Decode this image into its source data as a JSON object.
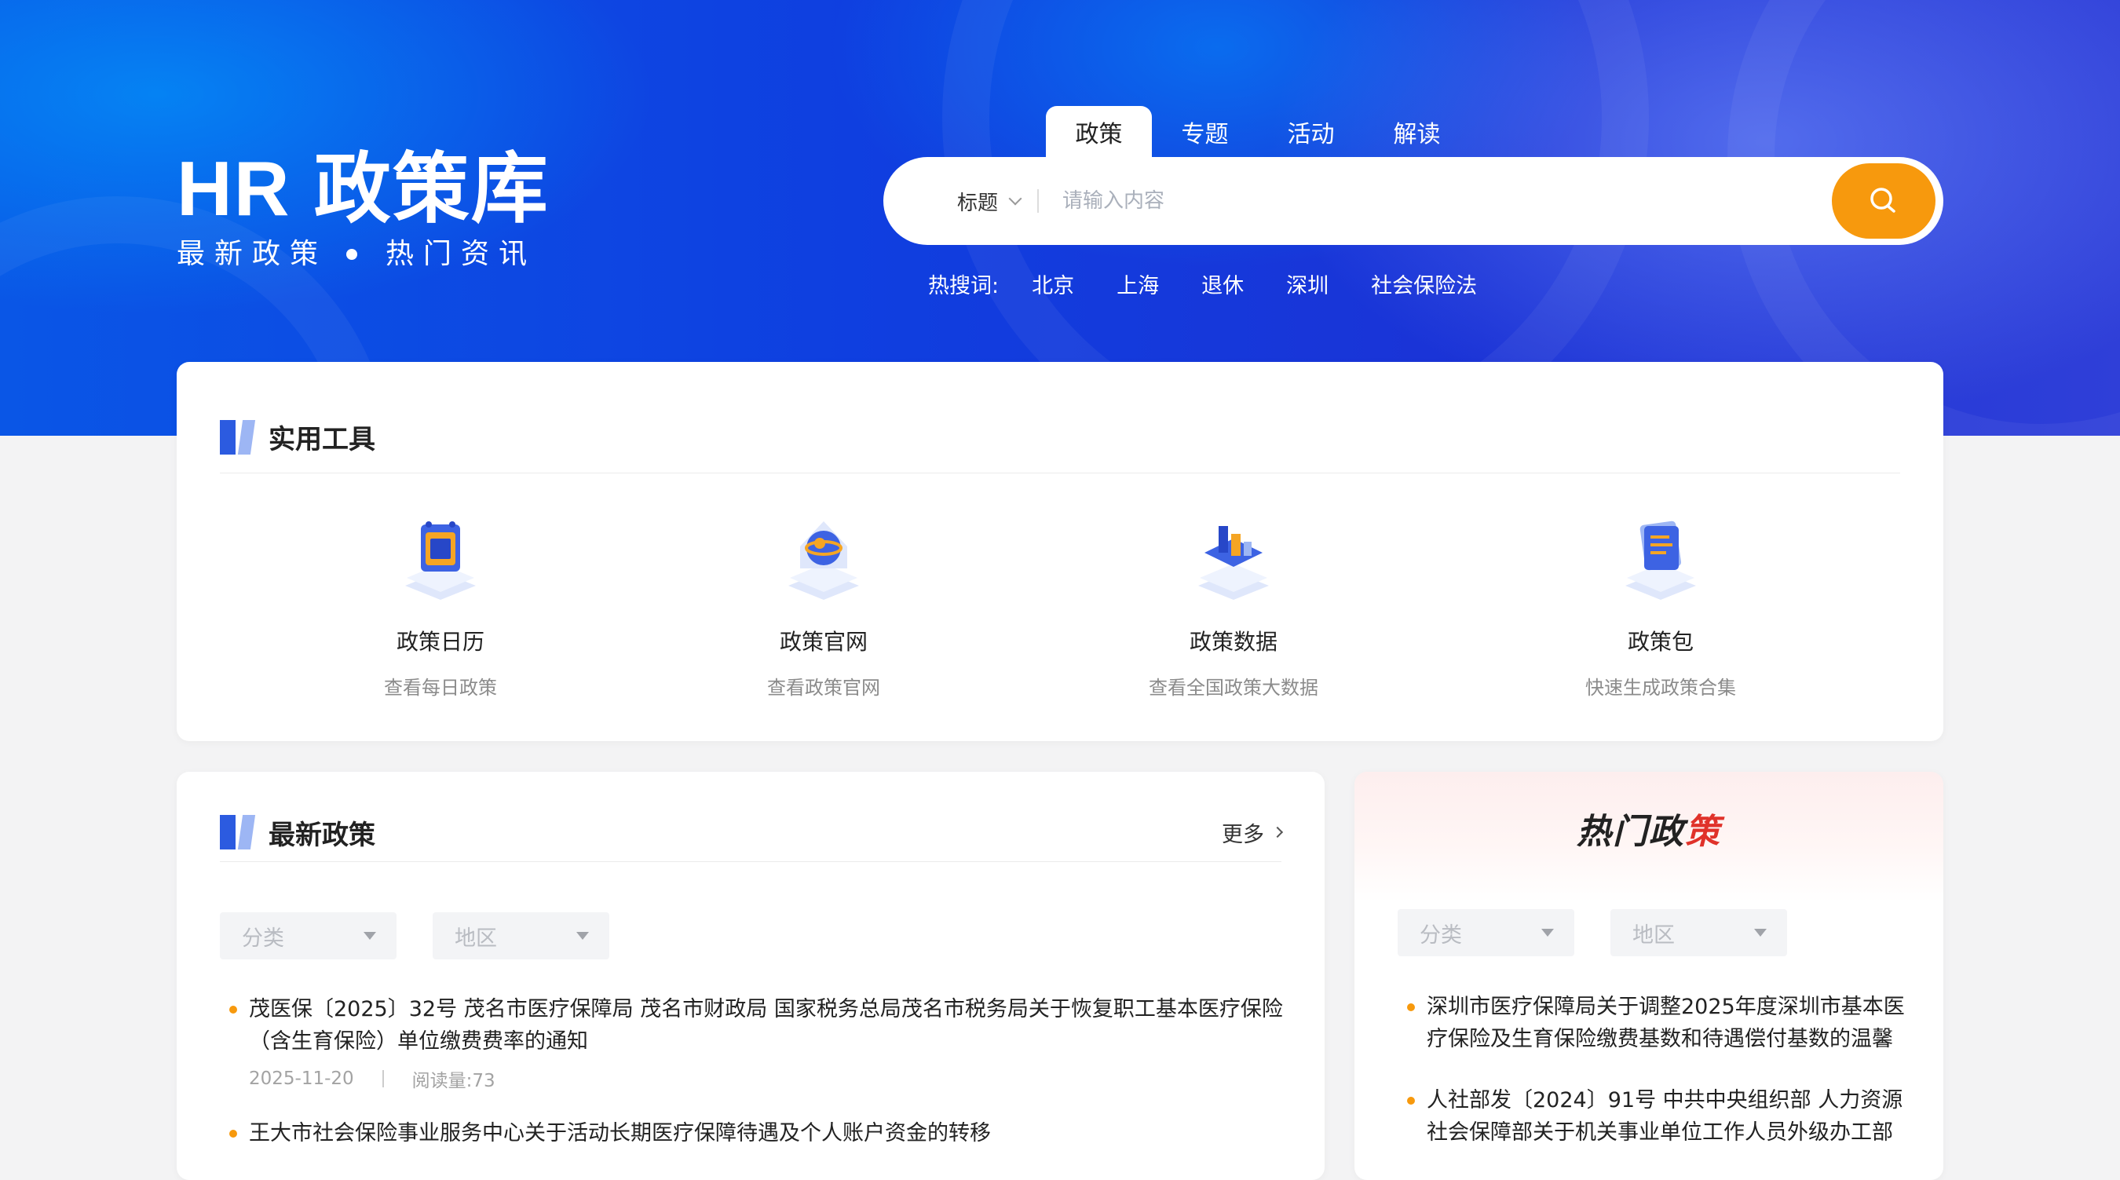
{
  "brand": {
    "title": "HR 政策库",
    "sub_left": "最新政策",
    "sub_right": "热门资讯"
  },
  "search": {
    "tabs": [
      {
        "label": "政策",
        "active": true
      },
      {
        "label": "专题",
        "active": false
      },
      {
        "label": "活动",
        "active": false
      },
      {
        "label": "解读",
        "active": false
      }
    ],
    "scope": "标题",
    "placeholder": "请输入内容",
    "button_icon": "search-icon"
  },
  "hotwords": {
    "label": "热搜词:",
    "items": [
      "北京",
      "上海",
      "退休",
      "深圳",
      "社会保险法"
    ]
  },
  "tools": {
    "title": "实用工具",
    "items": [
      {
        "name": "政策日历",
        "desc": "查看每日政策",
        "icon": "calendar-icon"
      },
      {
        "name": "政策官网",
        "desc": "查看政策官网",
        "icon": "globe-icon"
      },
      {
        "name": "政策数据",
        "desc": "查看全国政策大数据",
        "icon": "data-chart-icon"
      },
      {
        "name": "政策包",
        "desc": "快速生成政策合集",
        "icon": "document-pack-icon"
      }
    ]
  },
  "latest": {
    "title": "最新政策",
    "more": "更多",
    "filters": {
      "category": "分类",
      "region": "地区"
    },
    "items": [
      {
        "title": "茂医保〔2025〕32号 茂名市医疗保障局 茂名市财政局 国家税务总局茂名市税务局关于恢复职工基本医疗保险（含生育保险）单位缴费费率的通知",
        "date": "2025-11-20",
        "reads": "阅读量:73"
      },
      {
        "title": "王大市社会保险事业服务中心关于活动长期医疗保障待遇及个人账户资金的转移",
        "date": "",
        "reads": ""
      }
    ]
  },
  "hot": {
    "title_main": "热门政",
    "title_accent": "策",
    "filters": {
      "category": "分类",
      "region": "地区"
    },
    "items": [
      {
        "title": "深圳市医疗保障局关于调整2025年度深圳市基本医疗保险及生育保险缴费基数和待遇偿付基数的温馨"
      },
      {
        "title": "人社部发〔2024〕91号 中共中央组织部 人力资源社会保障部关于机关事业单位工作人员外级办工部"
      }
    ]
  },
  "colors": {
    "accent": "#f7990d",
    "brand_blue": "#2c5be0",
    "hot_red": "#e0322a"
  }
}
